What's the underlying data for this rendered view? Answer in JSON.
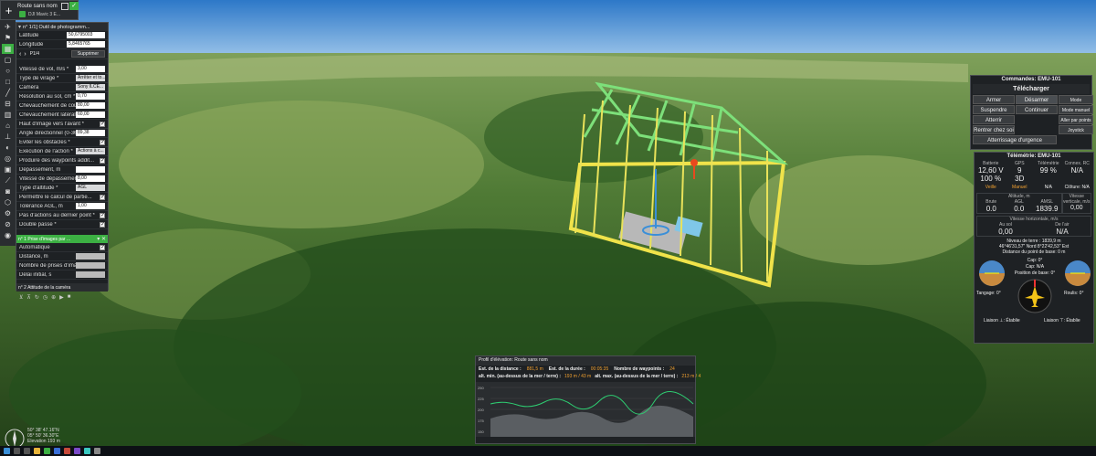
{
  "route": {
    "name": "Route sans nom",
    "drone": "DJI Mavic 3 E..."
  },
  "tool": {
    "title": "n° 1/1] Outil de photogramm...",
    "page": "P1/4",
    "delete_label": "Supprimer"
  },
  "coords": [
    {
      "label": "Latitude",
      "value": "50,6795003"
    },
    {
      "label": "Longitude",
      "value": "5,8465765"
    }
  ],
  "params": [
    {
      "label": "Vitesse de vol, m/s *",
      "value": "3,00",
      "kind": "field"
    },
    {
      "label": "Type de virage *",
      "value": "Arrêter et to...",
      "kind": "select"
    },
    {
      "label": "Caméra",
      "value": "Sony ILCE...",
      "kind": "select"
    },
    {
      "label": "Résolution au sol, cm *",
      "value": "0,70",
      "kind": "field"
    },
    {
      "label": "Chevauchement de cours, % *",
      "value": "80,00",
      "kind": "field"
    },
    {
      "label": "Chevauchement latéral, % *",
      "value": "60,00",
      "kind": "field"
    },
    {
      "label": "Haut d'image vers l'avant *",
      "value": "",
      "kind": "check"
    },
    {
      "label": "Angle directionnel (0-360)",
      "value": "89,38",
      "kind": "field"
    },
    {
      "label": "Eviter les obstacles *",
      "value": "",
      "kind": "check"
    },
    {
      "label": "Exécution de l'action *",
      "value": "Actions à c...",
      "kind": "select"
    },
    {
      "label": "Produire des waypoints addit...",
      "value": "",
      "kind": "check"
    },
    {
      "label": "Dépassement, m",
      "value": "",
      "kind": "field"
    },
    {
      "label": "Vitesse de dépassement, m/s",
      "value": "8,00",
      "kind": "field"
    },
    {
      "label": "Type d'altitude *",
      "value": "AGL",
      "kind": "select"
    },
    {
      "label": "Permettre le calcul de partie...",
      "value": "",
      "kind": "check"
    },
    {
      "label": "Tolérance AGL, m",
      "value": "1,00",
      "kind": "field"
    },
    {
      "label": "Pas d'actions au dernier point *",
      "value": "",
      "kind": "check"
    },
    {
      "label": "Double passe *",
      "value": "",
      "kind": "check"
    }
  ],
  "action1": {
    "title": "n° 1 Prise d'images par ...",
    "rows": [
      {
        "label": "Automatique",
        "value": ""
      },
      {
        "label": "Distance, m",
        "value": ""
      },
      {
        "label": "Nombre de prises d'image",
        "value": ""
      },
      {
        "label": "Délai initial, s",
        "value": ""
      }
    ]
  },
  "action2": {
    "title": "n° 2 Attitude de la caméra"
  },
  "commands": {
    "title": "Commandes: EMU-101",
    "upload": "Télécharger",
    "buttons": [
      [
        "Armer",
        "Désarmer",
        "Mode automatique"
      ],
      [
        "Suspendre",
        "Continuer",
        "Mode manuel"
      ],
      [
        "Atterrir",
        "",
        "Aller par points"
      ],
      [
        "Rentrer chez soi",
        "",
        "Joystick"
      ]
    ],
    "emergency": "Atterrissage d'urgence"
  },
  "telemetry": {
    "title": "Télémétrie: EMU-101",
    "headers": [
      "Batterie",
      "GPS",
      "Télémétrie",
      "Connex. RC"
    ],
    "row1": [
      "12,60 V",
      "9",
      "99 %",
      "N/A"
    ],
    "row2": [
      "100 %",
      "3D",
      "",
      ""
    ],
    "modes": [
      "Veille",
      "Manuel",
      "N/A",
      "Clôture: N/A"
    ],
    "alt_title": "Altitude, m",
    "alt_heads": [
      "Brute",
      "AGL",
      "AMSL"
    ],
    "alt_vals": [
      "0.0",
      "0.0",
      "1839.9"
    ],
    "vspeed_title": "Vitesse verticale, m/s",
    "vspeed_val": "0,00",
    "hspeed_title": "Vitesse horizontale, m/s",
    "hspeed_heads": [
      "Au sol",
      "De l'air"
    ],
    "hspeed_vals": [
      "0,00",
      "N/A"
    ],
    "ground_level": "Niveau de terre : 1839,9 m",
    "position": "46°46'31,57\" Nord   8°22'42,53\" Est",
    "home_dist": "Distance du point de base: 0 m",
    "cap": "Cap: 0°",
    "cap2": "Cap: N/A",
    "base_pos": "Position de base: 0°",
    "pitch": "Tangage: 0°",
    "roll": "Roulis: 0°",
    "link1": "Liaison ⊥: Établie",
    "link2": "Liaison ⊤: Établie"
  },
  "elevation": {
    "title": "Profil d'élévation: Route sans nom",
    "dist_label": "Est. de la distance :",
    "dist_val": "881,5 m",
    "dur_label": "Est. de la durée :",
    "dur_val": "00:05:35",
    "wp_label": "Nombre de waypoints :",
    "wp_val": "24",
    "amin_label": "alt. min. (au-dessus de la mer / terre) :",
    "amin_val": "193 m / 43 m",
    "amax_label": "alt. max. (au-dessus de la mer / terre) :",
    "amax_val": "213 m / 4",
    "yticks": [
      "250",
      "225",
      "200",
      "175",
      "150"
    ]
  },
  "hud": {
    "line1": "50° 38' 47.16\"N",
    "line2": "05° 50' 36.30\"E",
    "line3": "Elevation 193 m"
  },
  "colors": {
    "panel": "#1e2124",
    "accent_green": "#3cb043",
    "route_yellow": "#f0e34a",
    "elev_green": "#2ecc71"
  }
}
